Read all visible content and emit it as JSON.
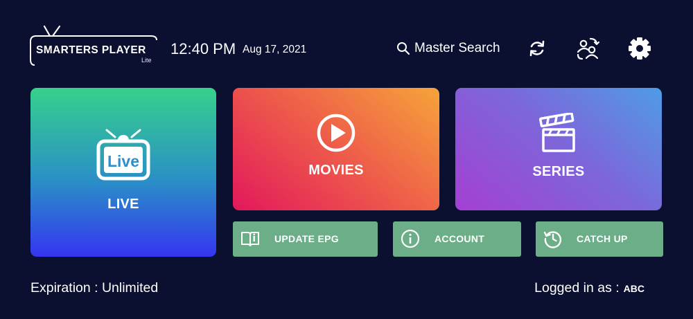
{
  "header": {
    "logo": {
      "main": "SMARTERS PLAYER",
      "sub": "Lite"
    },
    "time": "12:40 PM",
    "date": "Aug 17, 2021",
    "search_label": "Master Search",
    "icons": [
      "search-icon",
      "refresh-icon",
      "switch-user-icon",
      "settings-gear-icon"
    ]
  },
  "tiles": {
    "live": {
      "label": "LIVE",
      "icon_text": "Live",
      "icon": "tv-live-icon"
    },
    "movies": {
      "label": "MOVIES",
      "icon": "play-circle-icon"
    },
    "series": {
      "label": "SERIES",
      "icon": "clapperboard-icon"
    }
  },
  "buttons": {
    "update_epg": {
      "label": "UPDATE EPG",
      "icon": "book-icon"
    },
    "account": {
      "label": "ACCOUNT",
      "icon": "info-icon"
    },
    "catch_up": {
      "label": "CATCH UP",
      "icon": "history-icon"
    }
  },
  "footer": {
    "expiration": "Expiration : Unlimited",
    "logged_in_label": "Logged in as :",
    "username": "ABC"
  },
  "colors": {
    "background": "#0b0f30",
    "button_green": "#6bae87",
    "text": "#ffffff"
  }
}
